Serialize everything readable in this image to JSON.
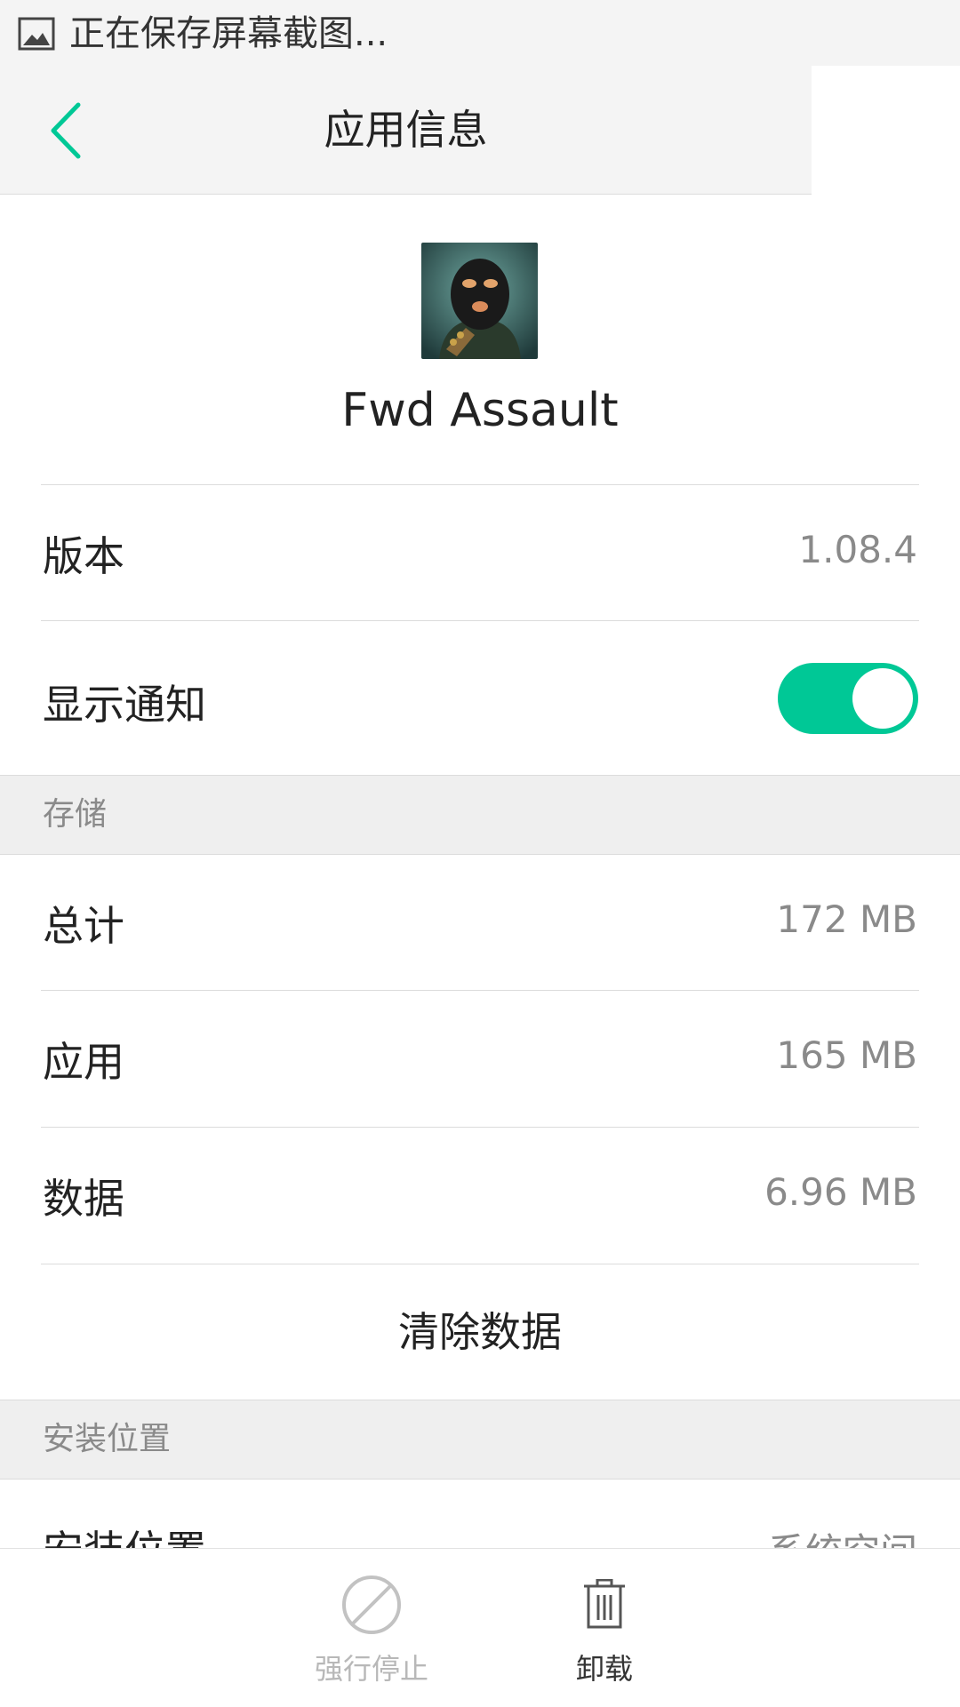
{
  "status_bar": {
    "text": "正在保存屏幕截图..."
  },
  "header": {
    "title": "应用信息"
  },
  "app": {
    "name": "Fwd Assault"
  },
  "rows": {
    "version": {
      "label": "版本",
      "value": "1.08.4"
    },
    "notification": {
      "label": "显示通知",
      "enabled": true
    }
  },
  "storage": {
    "section_label": "存储",
    "total": {
      "label": "总计",
      "value": "172 MB"
    },
    "app": {
      "label": "应用",
      "value": "165 MB"
    },
    "data": {
      "label": "数据",
      "value": "6.96 MB"
    },
    "clear_button": "清除数据"
  },
  "install": {
    "section_label": "安装位置",
    "location": {
      "label": "安装位置",
      "value": "系统空间"
    }
  },
  "bottom_bar": {
    "force_stop_label": "强行停止",
    "uninstall_label": "卸载"
  },
  "colors": {
    "accent": "#00c896",
    "toggle_on": "#00c896"
  }
}
